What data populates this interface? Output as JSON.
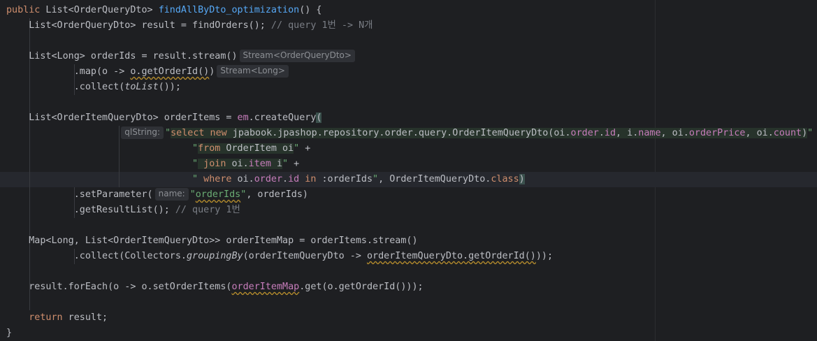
{
  "editor": {
    "lines": [
      {
        "tokens": [
          {
            "t": "public",
            "c": "kw"
          },
          {
            "t": " List<OrderQueryDto> "
          },
          {
            "t": "findAllByDto_optimization",
            "c": "fn"
          },
          {
            "t": "() {"
          }
        ]
      },
      {
        "tokens": [
          {
            "t": "    List<OrderQueryDto> result = findOrders(); "
          },
          {
            "t": "// query 1번 -> N개",
            "c": "cmt"
          }
        ]
      },
      {
        "tokens": []
      },
      {
        "tokens": [
          {
            "t": "    List<Long> orderIds = result.stream()"
          },
          {
            "hint": "Stream<OrderQueryDto>"
          }
        ]
      },
      {
        "tokens": [
          {
            "t": "            .map(o -> "
          },
          {
            "t": "o.getOrderId()",
            "c": "warn"
          },
          {
            "t": ")"
          },
          {
            "hint": "Stream<Long>"
          }
        ]
      },
      {
        "tokens": [
          {
            "t": "            .collect("
          },
          {
            "t": "toList",
            "c": "stat"
          },
          {
            "t": "());"
          }
        ]
      },
      {
        "tokens": []
      },
      {
        "tokens": [
          {
            "t": "    List<OrderItemQueryDto> orderItems = "
          },
          {
            "t": "em",
            "c": "field"
          },
          {
            "t": ".createQuery"
          },
          {
            "t": "(",
            "c": "bm"
          }
        ]
      },
      {
        "tokens": [
          {
            "t": "                    "
          },
          {
            "hint": "qlString:"
          },
          {
            "t": "\"",
            "c": "str"
          },
          {
            "t": "select new",
            "c": "kw inj"
          },
          {
            "t": " jpabook.jpashop.repository.order.query.OrderItemQueryDto(oi.",
            "c": "inj"
          },
          {
            "t": "order",
            "c": "field inj"
          },
          {
            "t": ".",
            "c": "inj"
          },
          {
            "t": "id",
            "c": "field inj"
          },
          {
            "t": ", i.",
            "c": "inj"
          },
          {
            "t": "name",
            "c": "field inj"
          },
          {
            "t": ", oi.",
            "c": "inj"
          },
          {
            "t": "orderPrice",
            "c": "field inj"
          },
          {
            "t": ", oi.",
            "c": "inj"
          },
          {
            "t": "count",
            "c": "field inj"
          },
          {
            "t": ")",
            "c": "inj"
          },
          {
            "t": "\"",
            "c": "str"
          },
          {
            "t": " +"
          }
        ]
      },
      {
        "tokens": [
          {
            "t": "                                 "
          },
          {
            "t": "\"",
            "c": "str"
          },
          {
            "t": "from",
            "c": "kw inj"
          },
          {
            "t": " OrderItem oi",
            "c": "inj"
          },
          {
            "t": "\"",
            "c": "str"
          },
          {
            "t": " +"
          }
        ]
      },
      {
        "tokens": [
          {
            "t": "                                 "
          },
          {
            "t": "\"",
            "c": "str"
          },
          {
            "t": " join",
            "c": "kw inj"
          },
          {
            "t": " oi.",
            "c": "inj"
          },
          {
            "t": "item",
            "c": "field inj"
          },
          {
            "t": " i",
            "c": "inj"
          },
          {
            "t": "\"",
            "c": "str"
          },
          {
            "t": " +"
          }
        ]
      },
      {
        "current": true,
        "tokens": [
          {
            "t": "                                 "
          },
          {
            "t": "\"",
            "c": "str"
          },
          {
            "t": " where",
            "c": "kw"
          },
          {
            "t": " oi."
          },
          {
            "t": "order",
            "c": "field"
          },
          {
            "t": "."
          },
          {
            "t": "id",
            "c": "field"
          },
          {
            "t": " in",
            "c": "kw"
          },
          {
            "t": " :orderIds"
          },
          {
            "t": "\"",
            "c": "str"
          },
          {
            "t": ", OrderItemQueryDto."
          },
          {
            "t": "class",
            "c": "kw"
          },
          {
            "t": ")",
            "c": "bm"
          }
        ]
      },
      {
        "tokens": [
          {
            "t": "            .setParameter("
          },
          {
            "hint": "name:"
          },
          {
            "t": "\"",
            "c": "str"
          },
          {
            "t": "orderIds",
            "c": "str warn"
          },
          {
            "t": "\"",
            "c": "str"
          },
          {
            "t": ", orderIds)"
          }
        ]
      },
      {
        "tokens": [
          {
            "t": "            .getResultList(); "
          },
          {
            "t": "// query 1번",
            "c": "cmt"
          }
        ]
      },
      {
        "tokens": []
      },
      {
        "tokens": [
          {
            "t": "    Map<Long, List<OrderItemQueryDto>> orderItemMap = orderItems.stream()"
          }
        ]
      },
      {
        "tokens": [
          {
            "t": "            .collect(Collectors."
          },
          {
            "t": "groupingBy",
            "c": "stat"
          },
          {
            "t": "(orderItemQueryDto -> "
          },
          {
            "t": "orderItemQueryDto.getOrderId()",
            "c": "warn"
          },
          {
            "t": "));"
          }
        ]
      },
      {
        "tokens": []
      },
      {
        "tokens": [
          {
            "t": "    result.forEach(o -> o.setOrderItems("
          },
          {
            "t": "orderItemMap",
            "c": "field warn"
          },
          {
            "t": ".get(o.getOrderId()));"
          }
        ]
      },
      {
        "tokens": []
      },
      {
        "tokens": [
          {
            "t": "    "
          },
          {
            "t": "return",
            "c": "kw"
          },
          {
            "t": " result;"
          }
        ]
      },
      {
        "tokens": [
          {
            "t": "}"
          }
        ]
      }
    ]
  }
}
